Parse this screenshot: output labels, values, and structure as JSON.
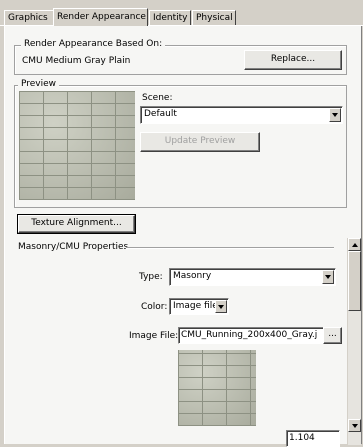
{
  "tabs": [
    {
      "label": "Graphics"
    },
    {
      "label": "Render Appearance"
    },
    {
      "label": "Identity"
    },
    {
      "label": "Physical"
    }
  ],
  "render_group": {
    "legend": "Render Appearance Based On:",
    "material_name": "CMU Medium Gray Plain",
    "replace_label": "Replace..."
  },
  "preview_group": {
    "legend": "Preview",
    "scene_label": "Scene:",
    "scene_value": "Default",
    "update_label": "Update Preview"
  },
  "texture_alignment_label": "Texture Alignment...",
  "masonry": {
    "title": "Masonry/CMU Properties",
    "type_label": "Type:",
    "type_value": "Masonry",
    "color_label": "Color:",
    "color_value": "Image file",
    "image_file_label": "Image File:",
    "image_file_value": "CMU_Running_200x400_Gray.j",
    "browse_label": "...",
    "bottom_value": "1.104"
  }
}
